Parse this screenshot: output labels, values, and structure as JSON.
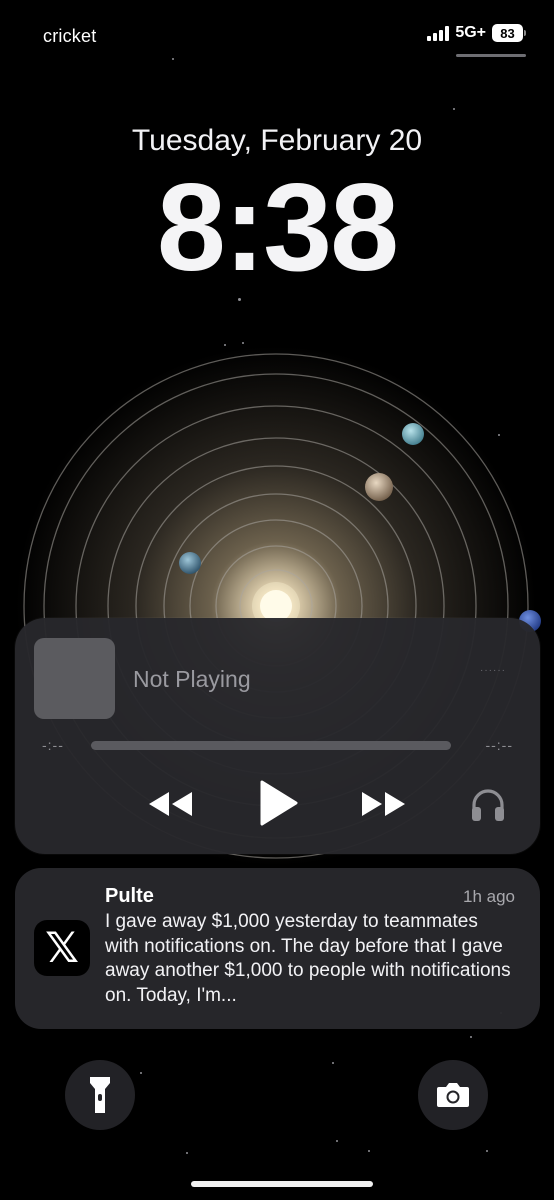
{
  "status_bar": {
    "carrier": "cricket",
    "network": "5G+",
    "battery": "83"
  },
  "lockscreen": {
    "date": "Tuesday, February 20",
    "time": "8:38"
  },
  "now_playing": {
    "title": "Not Playing",
    "elapsed": "-:--",
    "remaining": "--:--",
    "progress": 0,
    "controls": {
      "rewind": "rewind-icon",
      "play": "play-icon",
      "forward": "fast-forward-icon",
      "output": "headphones-icon"
    }
  },
  "notification": {
    "app_icon": "x-logo-icon",
    "title": "Pulte",
    "time": "1h ago",
    "body": "I gave away $1,000 yesterday to teammates with notifications on. The day before that I gave away another $1,000 to people with notifications on. Today, I'm..."
  },
  "quick_actions": {
    "left": "flashlight-icon",
    "right": "camera-icon"
  },
  "colors": {
    "background": "#000000",
    "card": "#28282c",
    "secondary_text": "#9a9aa0"
  }
}
